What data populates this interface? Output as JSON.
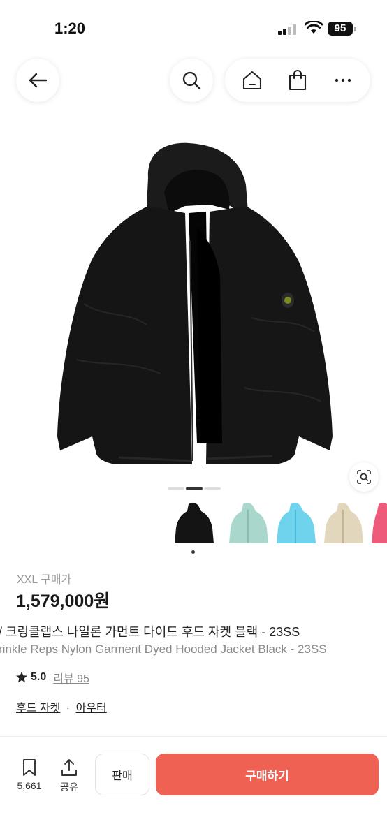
{
  "status_bar": {
    "time": "1:20",
    "battery": "95"
  },
  "nav": {
    "back_icon": "arrow-left-icon",
    "search_icon": "search-icon",
    "home_icon": "home-icon",
    "bag_icon": "shopping-bag-icon",
    "more_icon": "more-horizontal-icon"
  },
  "gallery": {
    "current_page": 2,
    "total_pages": 3,
    "thumbnails": [
      "black",
      "mint",
      "sky-blue",
      "beige",
      "pink"
    ],
    "selected_thumbnail": 1
  },
  "product": {
    "size": "XXL",
    "price_label": "구매가",
    "price": "1,579,000원",
    "name_ko": "/ 크링클랩스 나일론 가먼트 다이드 후드 자켓 블랙 - 23SS",
    "name_en": "rinkle Reps Nylon Garment Dyed Hooded Jacket Black - 23SS",
    "rating": "5.0",
    "review_label": "리뷰 95",
    "category_1": "후드 자켓",
    "category_sep": "·",
    "category_2": "아우터"
  },
  "bottom_bar": {
    "bookmark_count": "5,661",
    "share_label": "공유",
    "sell_label": "판매",
    "buy_label": "구매하기"
  },
  "colors": {
    "buy_button": "#ef6253",
    "text_primary": "#222222",
    "text_muted": "#8a8a8a"
  }
}
